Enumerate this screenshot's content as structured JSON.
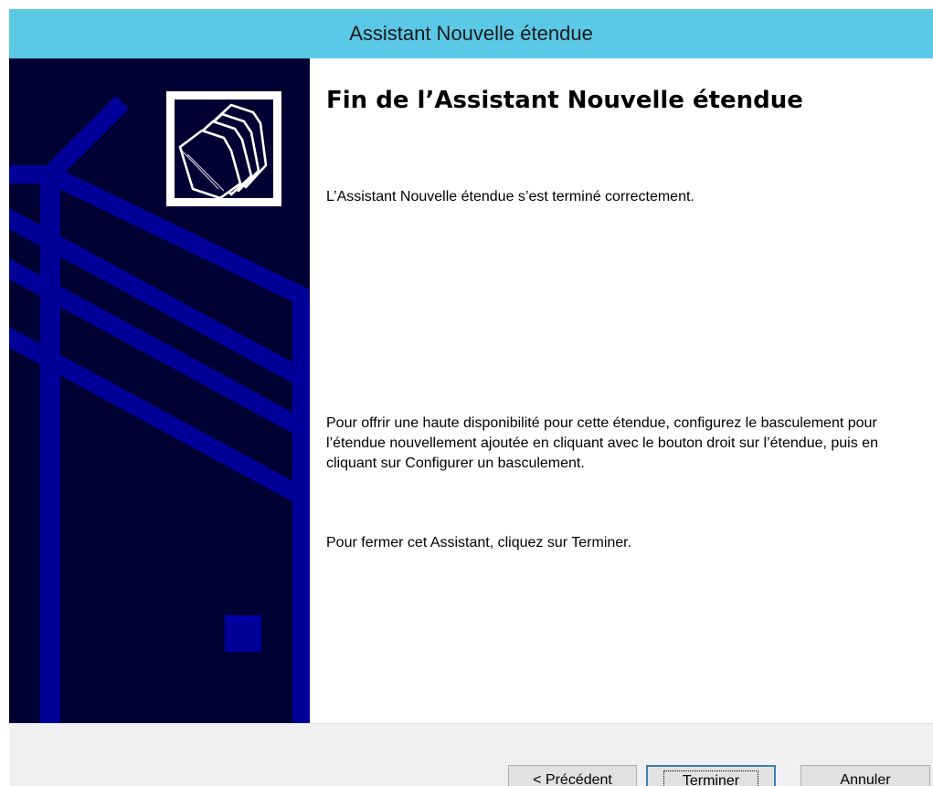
{
  "window": {
    "title": "Assistant Nouvelle étendue"
  },
  "content": {
    "heading": "Fin de l’Assistant Nouvelle étendue",
    "success_message": "L’Assistant Nouvelle étendue s’est terminé correctement.",
    "failover_info": "Pour offrir une haute disponibilité pour cette étendue, configurez le basculement pour l’étendue nouvellement ajoutée en cliquant avec le bouton droit sur l’étendue, puis en cliquant sur Configurer un basculement.",
    "close_info": "Pour fermer cet Assistant, cliquez sur Terminer."
  },
  "buttons": {
    "previous": "< Précédent",
    "finish": "Terminer",
    "cancel": "Annuler"
  },
  "icons": {
    "wizard_icon": "folders-icon"
  },
  "colors": {
    "titlebar": "#5bc8e6",
    "banner_background": "#000033",
    "banner_shapes": "#000099"
  }
}
